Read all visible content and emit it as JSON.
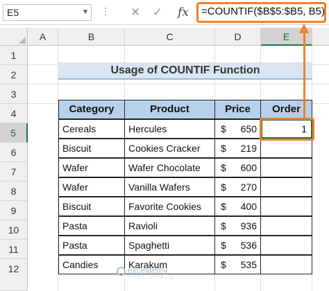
{
  "formula_bar": {
    "name_box": "E5",
    "cancel_icon": "✕",
    "enter_icon": "✓",
    "fx_label": "fx",
    "formula": "=COUNTIF($B$5:$B5, B5)"
  },
  "columns": [
    "A",
    "B",
    "C",
    "D",
    "E"
  ],
  "rows": [
    "1",
    "2",
    "3",
    "4",
    "5",
    "6",
    "7",
    "8",
    "9",
    "10",
    "11",
    "12"
  ],
  "selected_cell": "E5",
  "title": "Usage of COUNTIF Function",
  "table": {
    "headers": [
      "Category",
      "Product",
      "Price",
      "Order"
    ],
    "currency_symbol": "$",
    "rows": [
      {
        "category": "Cereals",
        "product": "Hercules",
        "price": "650",
        "order": "1"
      },
      {
        "category": "Biscuit",
        "product": "Cookies Cracker",
        "price": "219",
        "order": ""
      },
      {
        "category": "Wafer",
        "product": "Wafer Chocolate",
        "price": "600",
        "order": ""
      },
      {
        "category": "Wafer",
        "product": "Vanilla Wafers",
        "price": "270",
        "order": ""
      },
      {
        "category": "Biscuit",
        "product": "Favorite Cookies",
        "price": "400",
        "order": ""
      },
      {
        "category": "Pasta",
        "product": "Ravioli",
        "price": "936",
        "order": ""
      },
      {
        "category": "Pasta",
        "product": "Spaghetti",
        "price": "536",
        "order": ""
      },
      {
        "category": "Candies",
        "product": "Karakum",
        "price": "535",
        "order": ""
      }
    ]
  },
  "watermark": {
    "name": "exceldemy",
    "tagline": "EXCEL · DATA · BI"
  },
  "colors": {
    "accent_orange": "#f28025",
    "excel_green": "#217346",
    "header_fill": "#b7d1ea",
    "title_fill": "#dbe5f1"
  }
}
